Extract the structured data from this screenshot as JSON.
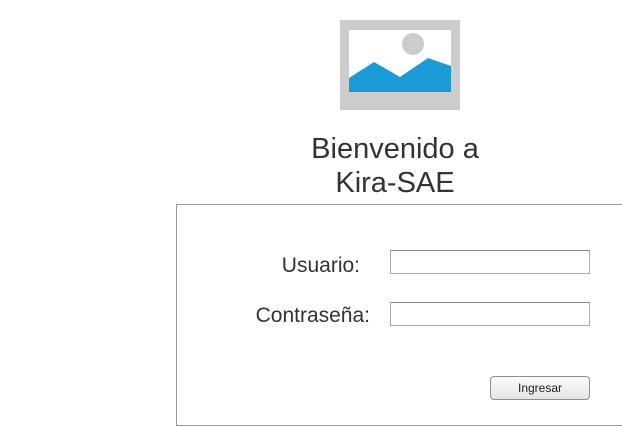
{
  "header": {
    "logo_icon": "image-placeholder-icon",
    "welcome_line1": "Bienvenido a",
    "welcome_line2": "Kira-SAE"
  },
  "login_form": {
    "username_label": "Usuario:",
    "username_value": "",
    "password_label": "Contraseña:",
    "password_value": "",
    "submit_label": "Ingresar"
  },
  "colors": {
    "logo_background": "#cccccc",
    "logo_mountain": "#1a9bd7",
    "logo_sun": "#cccccc",
    "text": "#333333",
    "border": "#9a9a9a"
  }
}
